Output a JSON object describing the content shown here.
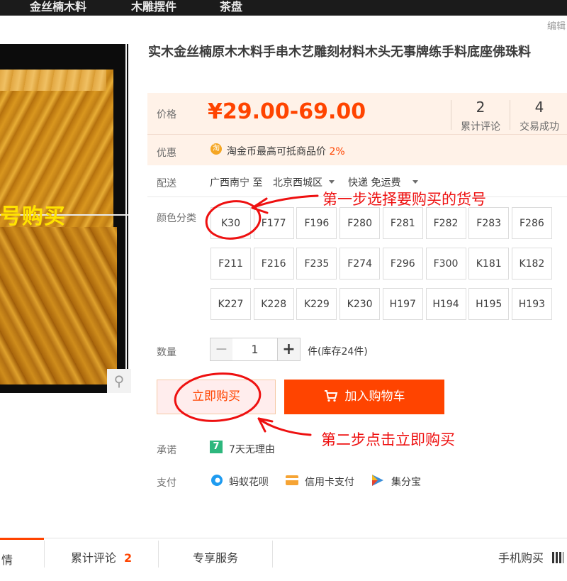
{
  "topnav": {
    "items": [
      "金丝楠木料",
      "木雕摆件",
      "茶盘"
    ]
  },
  "edit_link": "编辑",
  "gallery": {
    "banner": "号购买"
  },
  "product": {
    "title": "实木金丝楠原木木料手串木艺雕刻材料木头无事牌练手料底座佛珠料",
    "price_label": "价格",
    "price": "¥29.00-69.00",
    "reviews_count": "2",
    "reviews_label": "累计评论",
    "sales_count": "4",
    "sales_label": "交易成功",
    "promo_label": "优惠",
    "promo_text": "淘金币最高可抵商品价",
    "promo_rate": "2%",
    "shipping_label": "配送",
    "ship_from": "广西南宁 至",
    "ship_to": "北京西城区",
    "ship_method": "快递 免运费",
    "color_label": "颜色分类",
    "skus": [
      "K30",
      "F177",
      "F196",
      "F280",
      "F281",
      "F282",
      "F283",
      "F286",
      "F211",
      "F216",
      "F235",
      "F274",
      "F296",
      "F300",
      "K181",
      "K182",
      "K227",
      "K228",
      "K229",
      "K230",
      "H197",
      "H194",
      "H195",
      "H193"
    ],
    "qty_label": "数量",
    "qty_value": "1",
    "qty_minus": "−",
    "qty_plus": "+",
    "stock_text": "件(库存24件)",
    "buy_now": "立即购买",
    "add_to_cart": "加入购物车",
    "promise_label": "承诺",
    "promise_icon_text": "7",
    "promise_text": "7天无理由",
    "pay_label": "支付",
    "pay_methods": [
      "蚂蚁花呗",
      "信用卡支付",
      "集分宝"
    ]
  },
  "annotations": {
    "step1": "第一步选择要购买的货号",
    "step2": "第二步点击立即购买"
  },
  "tabs": {
    "details_partial": "情",
    "reviews_label": "累计评论",
    "reviews_count": "2",
    "service_label": "专享服务",
    "mobile_buy": "手机购买"
  },
  "colors": {
    "accent": "#ff4400",
    "annotation": "#ee1010",
    "price_bg": "#fff2e8"
  }
}
